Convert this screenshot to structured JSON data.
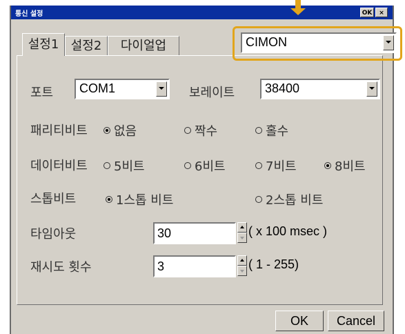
{
  "window": {
    "title": "통신 설정",
    "ok_label": "OK",
    "close_label": "×"
  },
  "tabs": [
    {
      "label": "설정1",
      "active": true
    },
    {
      "label": "설정2",
      "active": false
    },
    {
      "label": "다이얼업",
      "active": false
    }
  ],
  "device_select": {
    "value": "CIMON"
  },
  "port": {
    "label": "포트",
    "value": "COM1"
  },
  "baud": {
    "label": "보레이트",
    "value": "38400"
  },
  "parity": {
    "label": "패리티비트",
    "options": [
      {
        "label": "없음",
        "selected": true
      },
      {
        "label": "짝수",
        "selected": false
      },
      {
        "label": "홀수",
        "selected": false
      }
    ]
  },
  "databits": {
    "label": "데이터비트",
    "options": [
      {
        "label": "5비트",
        "selected": false
      },
      {
        "label": "6비트",
        "selected": false
      },
      {
        "label": "7비트",
        "selected": false
      },
      {
        "label": "8비트",
        "selected": true
      }
    ]
  },
  "stopbits": {
    "label": "스톱비트",
    "options": [
      {
        "label": "1스톱 비트",
        "selected": true
      },
      {
        "label": "2스톱 비트",
        "selected": false
      }
    ]
  },
  "timeout": {
    "label": "타임아웃",
    "value": "30",
    "unit": "( x 100 msec )"
  },
  "retry": {
    "label": "재시도 횟수",
    "value": "3",
    "range": "( 1 - 255)"
  },
  "buttons": {
    "ok": "OK",
    "cancel": "Cancel"
  },
  "colors": {
    "titlebar": "#0a2f9f",
    "dialog_bg": "#d4d0c8",
    "highlight": "#e2a51c"
  }
}
